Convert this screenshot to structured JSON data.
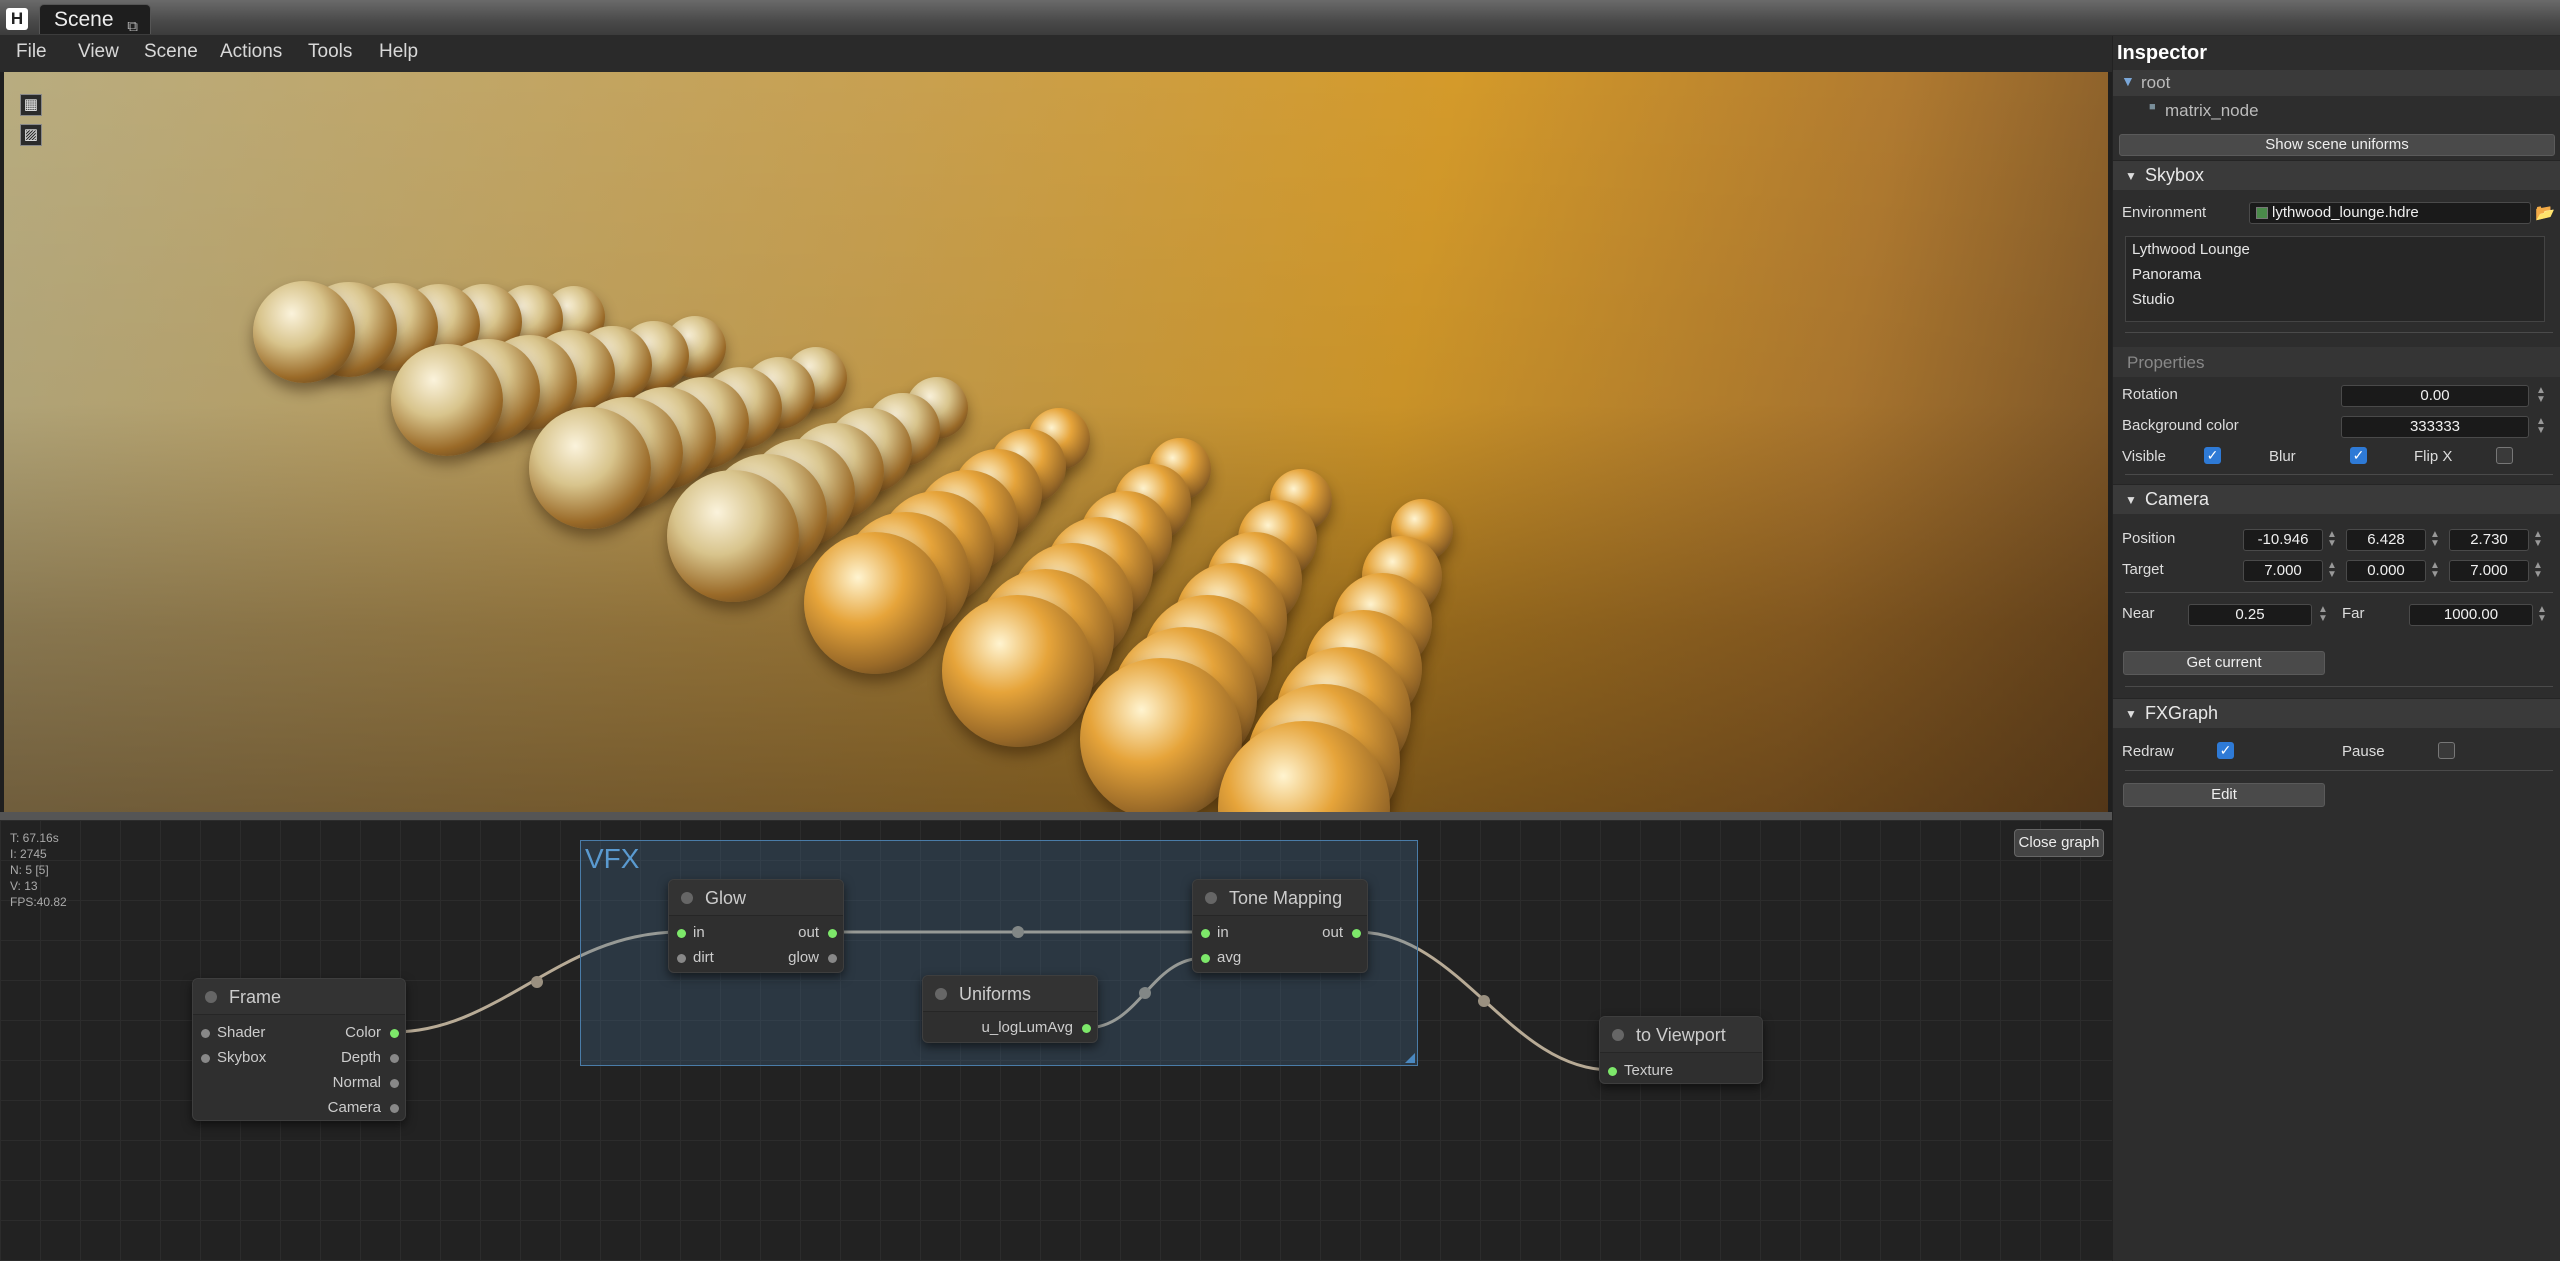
{
  "app": {
    "tab_label": "Scene",
    "undock_icon": "undock-icon"
  },
  "menu": [
    "File",
    "View",
    "Scene",
    "Actions",
    "Tools",
    "Help"
  ],
  "viewport": {
    "tools": [
      "grid-icon",
      "image-icon"
    ]
  },
  "graph": {
    "stats": [
      "T: 67.16s",
      "I: 2745",
      "N: 5 [5]",
      "V: 13",
      "FPS:40.82"
    ],
    "close_label": "Close graph",
    "group_title": "VFX",
    "nodes": {
      "frame": {
        "title": "Frame",
        "inputs": [
          "Shader",
          "Skybox"
        ],
        "outputs": [
          "Color",
          "Depth",
          "Normal",
          "Camera"
        ]
      },
      "glow": {
        "title": "Glow",
        "inputs": [
          "in",
          "dirt"
        ],
        "outputs": [
          "out",
          "glow"
        ]
      },
      "uniforms": {
        "title": "Uniforms",
        "outputs": [
          "u_logLumAvg"
        ]
      },
      "tonemap": {
        "title": "Tone Mapping",
        "inputs": [
          "in",
          "avg"
        ],
        "outputs": [
          "out"
        ]
      },
      "viewport": {
        "title": "to Viewport",
        "inputs": [
          "Texture"
        ]
      }
    }
  },
  "inspector": {
    "title": "Inspector",
    "tree": {
      "root": "root",
      "child": "matrix_node"
    },
    "show_uniforms": "Show scene uniforms",
    "skybox": {
      "section": "Skybox",
      "env_label": "Environment",
      "env_value": "lythwood_lounge.hdre",
      "list": [
        "Lythwood Lounge",
        "Panorama",
        "Studio"
      ],
      "properties_label": "Properties",
      "rotation_label": "Rotation",
      "rotation_value": "0.00",
      "bg_label": "Background color",
      "bg_value": "333333",
      "visible_label": "Visible",
      "blur_label": "Blur",
      "flipx_label": "Flip X",
      "visible": true,
      "blur": true,
      "flipx": false
    },
    "camera": {
      "section": "Camera",
      "position_label": "Position",
      "position": [
        "-10.946",
        "6.428",
        "2.730"
      ],
      "target_label": "Target",
      "target": [
        "7.000",
        "0.000",
        "7.000"
      ],
      "near_label": "Near",
      "near": "0.25",
      "far_label": "Far",
      "far": "1000.00",
      "get_current": "Get current"
    },
    "fxgraph": {
      "section": "FXGraph",
      "redraw_label": "Redraw",
      "pause_label": "Pause",
      "redraw": true,
      "pause": false,
      "edit_label": "Edit"
    }
  },
  "colors": {
    "accent": "#2e7ad6",
    "pin_on": "#7de86a",
    "group": "#4a7ca8"
  }
}
